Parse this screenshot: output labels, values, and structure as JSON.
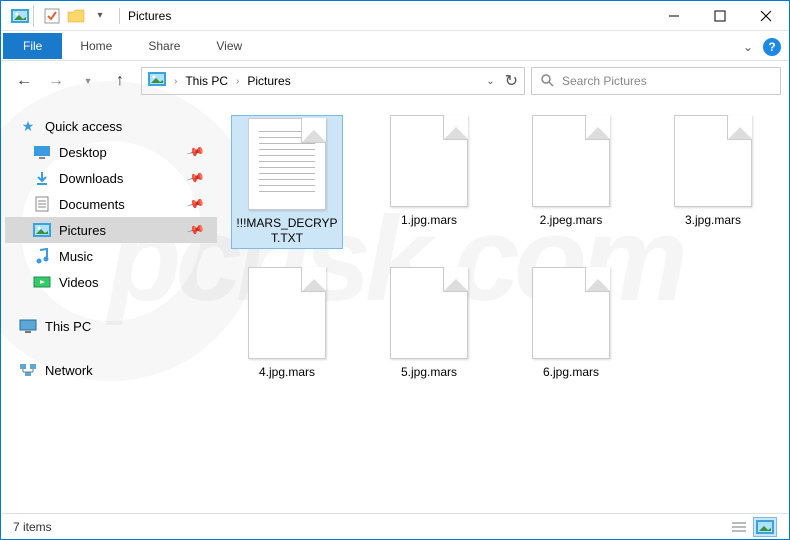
{
  "window": {
    "title": "Pictures"
  },
  "ribbon": {
    "file": "File",
    "tabs": [
      "Home",
      "Share",
      "View"
    ]
  },
  "breadcrumb": {
    "root": "This PC",
    "current": "Pictures"
  },
  "search": {
    "placeholder": "Search Pictures"
  },
  "sidebar": {
    "quick_access": "Quick access",
    "items": [
      {
        "label": "Desktop",
        "pinned": true
      },
      {
        "label": "Downloads",
        "pinned": true
      },
      {
        "label": "Documents",
        "pinned": true
      },
      {
        "label": "Pictures",
        "pinned": true,
        "selected": true
      },
      {
        "label": "Music",
        "pinned": false
      },
      {
        "label": "Videos",
        "pinned": false
      }
    ],
    "this_pc": "This PC",
    "network": "Network"
  },
  "files": [
    {
      "name": "!!!MARS_DECRYPT.TXT",
      "type": "txt",
      "selected": true
    },
    {
      "name": "1.jpg.mars",
      "type": "blank"
    },
    {
      "name": "2.jpeg.mars",
      "type": "blank"
    },
    {
      "name": "3.jpg.mars",
      "type": "blank"
    },
    {
      "name": "4.jpg.mars",
      "type": "blank"
    },
    {
      "name": "5.jpg.mars",
      "type": "blank"
    },
    {
      "name": "6.jpg.mars",
      "type": "blank"
    }
  ],
  "statusbar": {
    "count": "7 items"
  },
  "watermark": "pcrisk.com"
}
